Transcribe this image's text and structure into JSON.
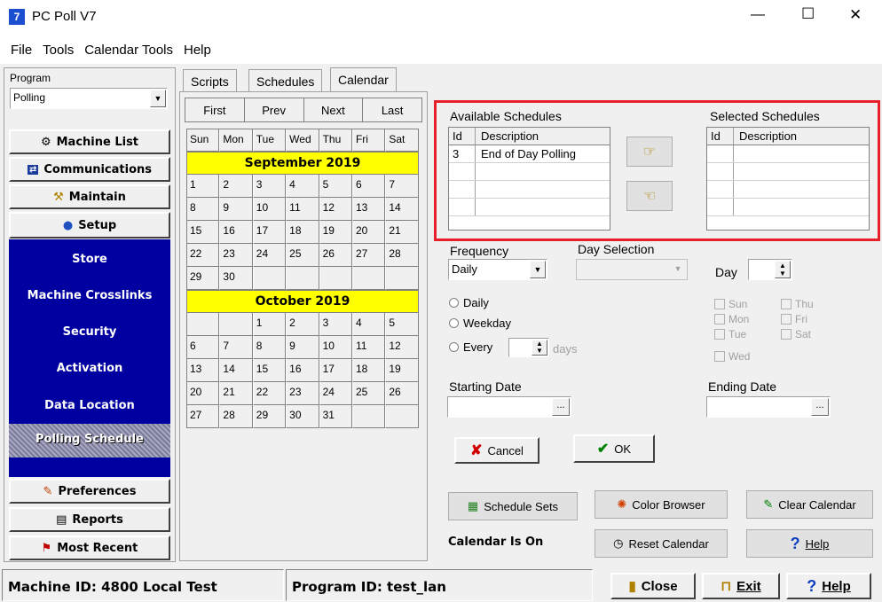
{
  "window": {
    "title": "PC Poll V7",
    "minimize": "—",
    "maximize": "☐",
    "close": "✕"
  },
  "menu": [
    "File",
    "Tools",
    "Calendar Tools",
    "Help"
  ],
  "program": {
    "label": "Program",
    "value": "Polling"
  },
  "nav": {
    "machine_list": "Machine List",
    "communications": "Communications",
    "maintain": "Maintain",
    "setup": "Setup",
    "submenu": [
      "Store",
      "Machine Crosslinks",
      "Security",
      "Activation",
      "Data Location",
      "Polling Schedule"
    ],
    "preferences": "Preferences",
    "reports": "Reports",
    "most_recent": "Most Recent"
  },
  "tabs": [
    "Scripts",
    "Schedules",
    "Calendar"
  ],
  "cal_nav": [
    "First",
    "Prev",
    "Next",
    "Last"
  ],
  "weekdays": [
    "Sun",
    "Mon",
    "Tue",
    "Wed",
    "Thu",
    "Fri",
    "Sat"
  ],
  "months": [
    {
      "name": "September 2019",
      "rows": [
        [
          "1",
          "2",
          "3",
          "4",
          "5",
          "6",
          "7"
        ],
        [
          "8",
          "9",
          "10",
          "11",
          "12",
          "13",
          "14"
        ],
        [
          "15",
          "16",
          "17",
          "18",
          "19",
          "20",
          "21"
        ],
        [
          "22",
          "23",
          "24",
          "25",
          "26",
          "27",
          "28"
        ],
        [
          "29",
          "30",
          "",
          "",
          "",
          "",
          ""
        ]
      ]
    },
    {
      "name": "October 2019",
      "rows": [
        [
          "",
          "",
          "1",
          "2",
          "3",
          "4",
          "5"
        ],
        [
          "6",
          "7",
          "8",
          "9",
          "10",
          "11",
          "12"
        ],
        [
          "13",
          "14",
          "15",
          "16",
          "17",
          "18",
          "19"
        ],
        [
          "20",
          "21",
          "22",
          "23",
          "24",
          "25",
          "26"
        ],
        [
          "27",
          "28",
          "29",
          "30",
          "31",
          "",
          ""
        ]
      ]
    }
  ],
  "available": {
    "title": "Available Schedules",
    "col_id": "Id",
    "col_desc": "Description",
    "rows": [
      {
        "id": "3",
        "desc": "End of Day Polling"
      }
    ]
  },
  "selected": {
    "title": "Selected Schedules",
    "col_id": "Id",
    "col_desc": "Description",
    "rows": []
  },
  "frequency": {
    "label": "Frequency",
    "value": "Daily"
  },
  "day_selection": {
    "label": "Day Selection",
    "value": ""
  },
  "day": {
    "label": "Day",
    "value": ""
  },
  "radios": {
    "daily": "Daily",
    "weekday": "Weekday",
    "every": "Every",
    "days": "days"
  },
  "weekday_checks": [
    "Sun",
    "Mon",
    "Tue",
    "Wed",
    "Thu",
    "Fri",
    "Sat"
  ],
  "starting_date": {
    "label": "Starting Date",
    "value": ""
  },
  "ending_date": {
    "label": "Ending Date",
    "value": ""
  },
  "buttons": {
    "cancel": "Cancel",
    "ok": "OK",
    "schedule_sets": "Schedule Sets",
    "color_browser": "Color Browser",
    "clear_calendar": "Clear Calendar",
    "reset_calendar": "Reset Calendar",
    "help": "Help",
    "close": "Close",
    "exit": "Exit",
    "help2": "Help",
    "ellipsis": "..."
  },
  "calendar_status": "Calendar Is On",
  "status": {
    "machine_id": "Machine ID: 4800 Local Test",
    "program_id": "Program ID: test_lan"
  },
  "colors": {
    "nav_blue": "#0000a0",
    "highlight_red": "#e8202a",
    "month_yellow": "#ffff00"
  }
}
